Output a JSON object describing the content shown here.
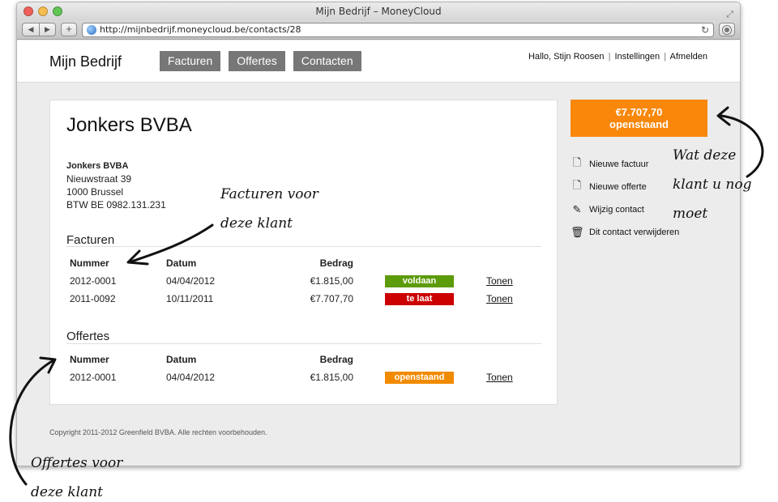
{
  "browser": {
    "window_title": "Mijn Bedrijf – MoneyCloud",
    "url": "http://mijnbedrijf.moneycloud.be/contacts/28",
    "icons": [
      "back-icon",
      "forward-icon",
      "add-tab-icon",
      "globe-icon",
      "reload-icon",
      "reader-icon",
      "resize-icon"
    ]
  },
  "header": {
    "brand": "Mijn Bedrijf",
    "nav": [
      "Facturen",
      "Offertes",
      "Contacten"
    ],
    "greeting": "Hallo, Stijn Roosen",
    "settings_link": "Instellingen",
    "logout_link": "Afmelden",
    "separator": "|"
  },
  "contact": {
    "title": "Jonkers BVBA",
    "name": "Jonkers BVBA",
    "street": "Nieuwstraat 39",
    "city": "1000 Brussel",
    "vat": "BTW BE 0982.131.231"
  },
  "invoices": {
    "title": "Facturen",
    "columns": [
      "Nummer",
      "Datum",
      "Bedrag"
    ],
    "rows": [
      {
        "number": "2012-0001",
        "date": "04/04/2012",
        "amount": "€1.815,00",
        "status": "voldaan",
        "action": "Tonen"
      },
      {
        "number": "2011-0092",
        "date": "10/11/2011",
        "amount": "€7.707,70",
        "status": "te laat",
        "action": "Tonen"
      }
    ]
  },
  "quotes": {
    "title": "Offertes",
    "columns": [
      "Nummer",
      "Datum",
      "Bedrag"
    ],
    "rows": [
      {
        "number": "2012-0001",
        "date": "04/04/2012",
        "amount": "€1.815,00",
        "status": "openstaand",
        "action": "Tonen"
      }
    ]
  },
  "sidebar": {
    "outstanding_amount": "€7.707,70",
    "outstanding_label": "openstaand",
    "actions": [
      {
        "label": "Nieuwe factuur",
        "icon": "new-invoice-icon"
      },
      {
        "label": "Nieuwe offerte",
        "icon": "new-quote-icon"
      },
      {
        "label": "Wijzig contact",
        "icon": "pencil-icon"
      },
      {
        "label": "Dit contact verwijderen",
        "icon": "trash-icon"
      }
    ]
  },
  "footer": "Copyright 2011-2012 Greenfield BVBA. Alle rechten voorbehouden.",
  "annotations": {
    "invoices_line1": "Facturen voor",
    "invoices_line2": "deze klant",
    "outstanding_line1": "Wat deze",
    "outstanding_line2": "klant u nog",
    "outstanding_line3": "moet",
    "quotes_line1": "Offertes voor",
    "quotes_line2": "deze klant"
  },
  "colors": {
    "accent_orange": "#f8870a",
    "status_paid": "#5c9b0a",
    "status_late": "#cc0000",
    "status_open": "#f28a00",
    "nav_gray": "#777777"
  }
}
